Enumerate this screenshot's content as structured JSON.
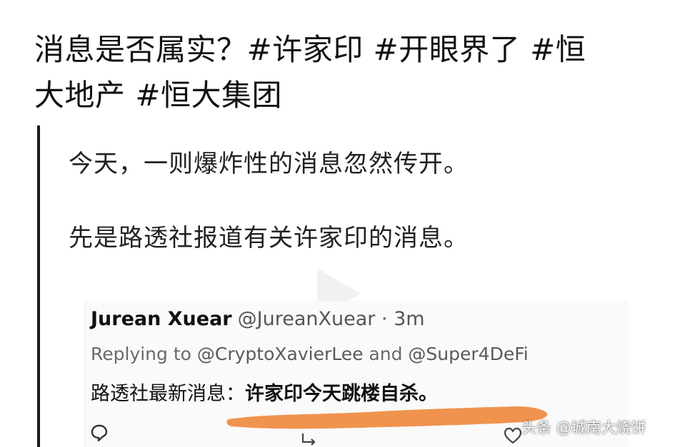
{
  "post": {
    "title_line_1": "消息是否属实？#许家印 #开眼界了 #恒",
    "title_line_2": "大地产 #恒大集团"
  },
  "quote": {
    "line_1": "今天，一则爆炸性的消息忽然传开。",
    "line_2": "先是路透社报道有关许家印的消息。"
  },
  "tweet": {
    "name": "Jurean Xuear",
    "handle": "@JureanXuear · 3m",
    "reply_prefix": "Replying to ",
    "reply_mention_1": "@CryptoXavierLee",
    "reply_and": " and ",
    "reply_mention_2": "@Super4DeFi",
    "body_prefix": "路透社最新消息：",
    "body_emphasis": "许家印今天跳楼自杀。"
  },
  "watermark": {
    "text": "头条 @城南大烧饼"
  },
  "icons": {
    "reply": "reply-bubble-icon",
    "retweet": "retweet-icon",
    "like": "heart-icon",
    "play": "play-icon"
  },
  "colors": {
    "scribble": "#f0934e",
    "quote_bar": "#1a1a1a",
    "tweet_bg": "#fafafa"
  }
}
